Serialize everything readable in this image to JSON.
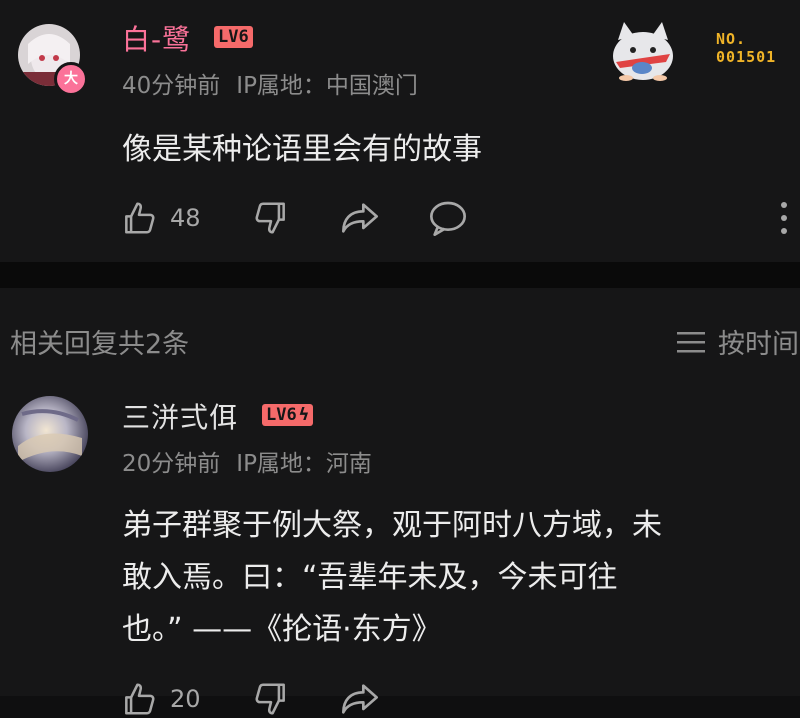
{
  "comment1": {
    "username": "白-鹭",
    "level": "LV6",
    "avatar_badge": "大",
    "time": "40分钟前",
    "ip": "IP属地：中国澳门",
    "content": "像是某种论语里会有的故事",
    "likes": "48",
    "fan_badge": {
      "line1": "NO.",
      "line2": "001501"
    },
    "username_color": "#fb7299"
  },
  "replies": {
    "header": "相关回复共2条",
    "sort_label": "按时间"
  },
  "comment2": {
    "username": "三洴弍佴",
    "level": "LV6",
    "time": "20分钟前",
    "ip": "IP属地：河南",
    "content_lines": [
      "弟子群聚于例大祭，观于阿时八方域，未",
      "敢入焉。曰：“吾辈年未及，今未可往",
      "也。” ——《抡语·东方》"
    ],
    "likes": "20"
  },
  "icons": [
    "thumbs-up-icon",
    "thumbs-down-icon",
    "share-icon",
    "comment-icon",
    "more-vertical-icon",
    "sort-icon"
  ]
}
